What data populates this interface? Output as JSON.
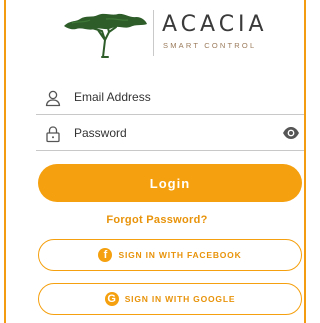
{
  "brand": {
    "name": "ACACIA",
    "tagline": "SMART CONTROL"
  },
  "form": {
    "email": {
      "placeholder": "Email Address",
      "value": ""
    },
    "password": {
      "placeholder": "Password",
      "value": ""
    },
    "login_label": "Login",
    "forgot_label": "Forgot Password?"
  },
  "social": {
    "facebook_label": "SIGN IN WITH FACEBOOK",
    "facebook_icon": "facebook-icon",
    "google_label": "SIGN IN WITH GOOGLE",
    "google_icon": "google-icon"
  },
  "icons": {
    "email": "person-icon",
    "password": "lock-icon",
    "toggle": "eye-icon"
  },
  "colors": {
    "accent": "#f5a00e",
    "border": "#f39c12",
    "logo_tree": "#2e5d2a"
  }
}
